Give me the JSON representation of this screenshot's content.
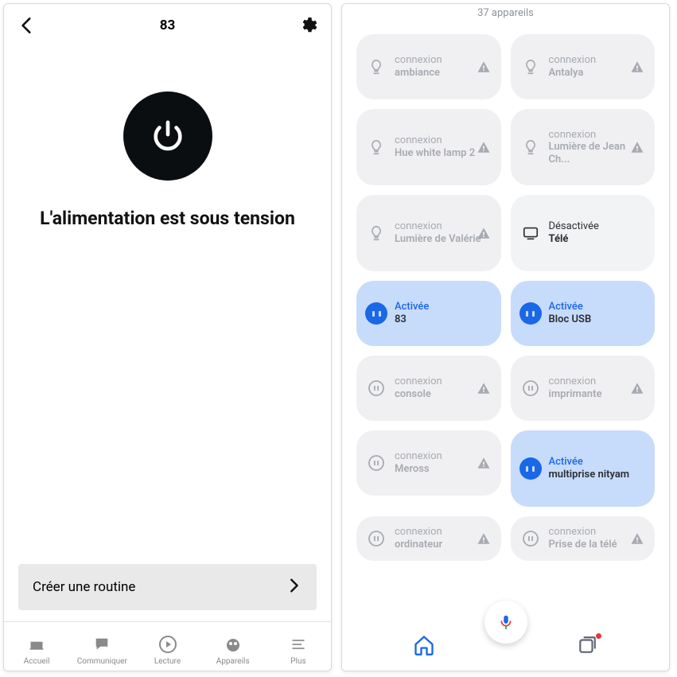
{
  "left": {
    "title": "83",
    "status": "L'alimentation est sous tension",
    "routine_cta": "Créer une routine",
    "tabs": {
      "accueil": "Accueil",
      "communiquer": "Communiquer",
      "lecture": "Lecture",
      "appareils": "Appareils",
      "plus": "Plus"
    }
  },
  "right": {
    "count_label": "37 appareils",
    "state": {
      "activee": "Activée",
      "desactivee": "Désactivée",
      "connexion": "connexion"
    },
    "tiles": [
      {
        "state": "connexion",
        "name": "ambiance",
        "icon": "bulb",
        "warn": true,
        "style": "off"
      },
      {
        "state": "connexion",
        "name": "Antalya",
        "icon": "bulb",
        "warn": true,
        "style": "off"
      },
      {
        "state": "connexion",
        "name": "Hue white lamp 2",
        "icon": "bulb",
        "warn": true,
        "style": "off",
        "big": true
      },
      {
        "state": "connexion",
        "name": "Lumière de Jean Ch...",
        "icon": "bulb",
        "warn": true,
        "style": "off",
        "big": true
      },
      {
        "state": "connexion",
        "name": "Lumière de Valérie",
        "icon": "bulb",
        "warn": true,
        "style": "off",
        "big": true
      },
      {
        "state": "desactivee",
        "name": "Télé",
        "icon": "tv",
        "warn": false,
        "style": "off-dark",
        "big": true
      },
      {
        "state": "activee",
        "name": "83",
        "icon": "outlet",
        "warn": false,
        "style": "on"
      },
      {
        "state": "activee",
        "name": "Bloc USB",
        "icon": "outlet",
        "warn": false,
        "style": "on"
      },
      {
        "state": "connexion",
        "name": "console",
        "icon": "outlet-o",
        "warn": true,
        "style": "off"
      },
      {
        "state": "connexion",
        "name": "imprimante",
        "icon": "outlet-o",
        "warn": true,
        "style": "off"
      },
      {
        "state": "connexion",
        "name": "Meross",
        "icon": "outlet-o",
        "warn": true,
        "style": "off"
      },
      {
        "state": "activee",
        "name": "multiprise nityam",
        "icon": "outlet",
        "warn": false,
        "style": "on",
        "big": true
      },
      {
        "state": "connexion",
        "name": "ordinateur",
        "icon": "outlet-o",
        "warn": true,
        "style": "off",
        "clip": true
      },
      {
        "state": "connexion",
        "name": "Prise de la télé",
        "icon": "outlet-o",
        "warn": true,
        "style": "off",
        "clip": true
      }
    ]
  }
}
